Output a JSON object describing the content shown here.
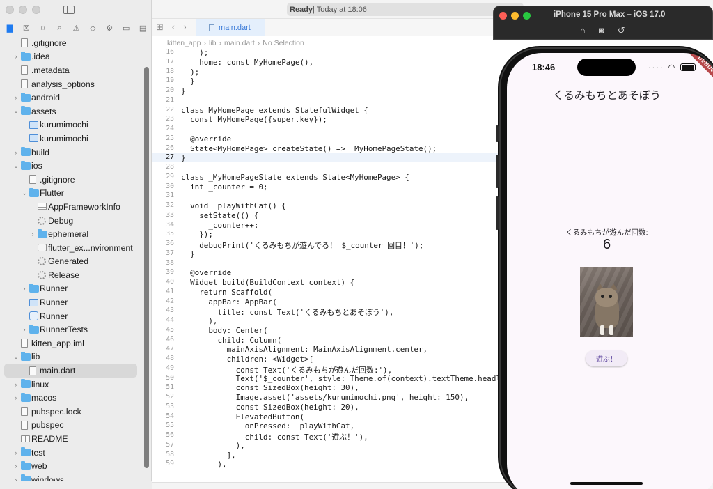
{
  "colors": {
    "accent": "#1f7bf0",
    "sidebar_bg": "#ececec",
    "folder": "#5fb2ec",
    "app_bg": "#fcf7fc",
    "button_text": "#6750a4",
    "debug_banner": "#b8484b"
  },
  "toolbar": {
    "status_bold": "Ready",
    "status_rest": " | Today at 18:06",
    "tab_label": "main.dart"
  },
  "breadcrumb": {
    "items": [
      "kitten_app",
      "lib",
      "main.dart",
      "No Selection"
    ]
  },
  "navigator": {
    "tree": [
      {
        "label": ".gitignore",
        "icon": "file",
        "depth": 0,
        "chevron": false
      },
      {
        "label": ".idea",
        "icon": "folder",
        "depth": 0,
        "chevron": "right"
      },
      {
        "label": ".metadata",
        "icon": "file",
        "depth": 0,
        "chevron": false
      },
      {
        "label": "analysis_options",
        "icon": "file",
        "depth": 0,
        "chevron": false
      },
      {
        "label": "android",
        "icon": "folder",
        "depth": 0,
        "chevron": "right"
      },
      {
        "label": "assets",
        "icon": "folder",
        "depth": 0,
        "chevron": "down"
      },
      {
        "label": "kurumimochi",
        "icon": "image",
        "depth": 1,
        "chevron": false
      },
      {
        "label": "kurumimochi",
        "icon": "image",
        "depth": 1,
        "chevron": false
      },
      {
        "label": "build",
        "icon": "folder",
        "depth": 0,
        "chevron": "right"
      },
      {
        "label": "ios",
        "icon": "folder",
        "depth": 0,
        "chevron": "down"
      },
      {
        "label": ".gitignore",
        "icon": "file",
        "depth": 1,
        "chevron": false
      },
      {
        "label": "Flutter",
        "icon": "folder",
        "depth": 1,
        "chevron": "down"
      },
      {
        "label": "AppFrameworkInfo",
        "icon": "plist",
        "depth": 2,
        "chevron": false
      },
      {
        "label": "Debug",
        "icon": "gear",
        "depth": 2,
        "chevron": false
      },
      {
        "label": "ephemeral",
        "icon": "folder",
        "depth": 2,
        "chevron": "right"
      },
      {
        "label": "flutter_ex...nvironment",
        "icon": "xcfg",
        "depth": 2,
        "chevron": false
      },
      {
        "label": "Generated",
        "icon": "gear",
        "depth": 2,
        "chevron": false
      },
      {
        "label": "Release",
        "icon": "gear",
        "depth": 2,
        "chevron": false
      },
      {
        "label": "Runner",
        "icon": "folder",
        "depth": 1,
        "chevron": "right"
      },
      {
        "label": "Runner",
        "icon": "image",
        "depth": 1,
        "chevron": false
      },
      {
        "label": "Runner",
        "icon": "app",
        "depth": 1,
        "chevron": false
      },
      {
        "label": "RunnerTests",
        "icon": "folder",
        "depth": 1,
        "chevron": "right"
      },
      {
        "label": "kitten_app.iml",
        "icon": "file",
        "depth": 0,
        "chevron": false
      },
      {
        "label": "lib",
        "icon": "folder",
        "depth": 0,
        "chevron": "down"
      },
      {
        "label": "main.dart",
        "icon": "file",
        "depth": 1,
        "chevron": false,
        "selected": true
      },
      {
        "label": "linux",
        "icon": "folder",
        "depth": 0,
        "chevron": "right"
      },
      {
        "label": "macos",
        "icon": "folder",
        "depth": 0,
        "chevron": "right"
      },
      {
        "label": "pubspec.lock",
        "icon": "file",
        "depth": 0,
        "chevron": false
      },
      {
        "label": "pubspec",
        "icon": "file",
        "depth": 0,
        "chevron": false
      },
      {
        "label": "README",
        "icon": "book",
        "depth": 0,
        "chevron": false
      },
      {
        "label": "test",
        "icon": "folder",
        "depth": 0,
        "chevron": "right"
      },
      {
        "label": "web",
        "icon": "folder",
        "depth": 0,
        "chevron": "right"
      },
      {
        "label": "windows",
        "icon": "folder",
        "depth": 0,
        "chevron": "right"
      }
    ]
  },
  "code": {
    "current_line": 27,
    "lines": [
      {
        "n": 16,
        "t": "    );"
      },
      {
        "n": 17,
        "t": "    home: const MyHomePage(),"
      },
      {
        "n": 18,
        "t": "  );"
      },
      {
        "n": 19,
        "t": "  }"
      },
      {
        "n": 20,
        "t": "}"
      },
      {
        "n": 21,
        "t": ""
      },
      {
        "n": 22,
        "t": "class MyHomePage extends StatefulWidget {"
      },
      {
        "n": 23,
        "t": "  const MyHomePage({super.key});"
      },
      {
        "n": 24,
        "t": ""
      },
      {
        "n": 25,
        "t": "  @override"
      },
      {
        "n": 26,
        "t": "  State<MyHomePage> createState() => _MyHomePageState();"
      },
      {
        "n": 27,
        "t": "}"
      },
      {
        "n": 28,
        "t": ""
      },
      {
        "n": 29,
        "t": "class _MyHomePageState extends State<MyHomePage> {"
      },
      {
        "n": 30,
        "t": "  int _counter = 0;"
      },
      {
        "n": 31,
        "t": ""
      },
      {
        "n": 32,
        "t": "  void _playWithCat() {"
      },
      {
        "n": 33,
        "t": "    setState(() {"
      },
      {
        "n": 34,
        "t": "      _counter++;"
      },
      {
        "n": 35,
        "t": "    });"
      },
      {
        "n": 36,
        "t": "    debugPrint('くるみもちが遊んでる！ $_counter 回目！');"
      },
      {
        "n": 37,
        "t": "  }"
      },
      {
        "n": 38,
        "t": ""
      },
      {
        "n": 39,
        "t": "  @override"
      },
      {
        "n": 40,
        "t": "  Widget build(BuildContext context) {"
      },
      {
        "n": 41,
        "t": "    return Scaffold("
      },
      {
        "n": 42,
        "t": "      appBar: AppBar("
      },
      {
        "n": 43,
        "t": "        title: const Text('くるみもちとあそぼう'),"
      },
      {
        "n": 44,
        "t": "      ),"
      },
      {
        "n": 45,
        "t": "      body: Center("
      },
      {
        "n": 46,
        "t": "        child: Column("
      },
      {
        "n": 47,
        "t": "          mainAxisAlignment: MainAxisAlignment.center,"
      },
      {
        "n": 48,
        "t": "          children: <Widget>["
      },
      {
        "n": 49,
        "t": "            const Text('くるみもちが遊んだ回数:'),"
      },
      {
        "n": 50,
        "t": "            Text('$_counter', style: Theme.of(context).textTheme.headlineMe"
      },
      {
        "n": 51,
        "t": "            const SizedBox(height: 30),"
      },
      {
        "n": 52,
        "t": "            Image.asset('assets/kurumimochi.png', height: 150),"
      },
      {
        "n": 53,
        "t": "            const SizedBox(height: 20),"
      },
      {
        "n": 54,
        "t": "            ElevatedButton("
      },
      {
        "n": 55,
        "t": "              onPressed: _playWithCat,"
      },
      {
        "n": 56,
        "t": "              child: const Text('遊ぶ！'),"
      },
      {
        "n": 57,
        "t": "            ),"
      },
      {
        "n": 58,
        "t": "          ],"
      },
      {
        "n": 59,
        "t": "        ),"
      }
    ]
  },
  "simulator": {
    "window_title": "iPhone 15 Pro Max – iOS 17.0",
    "status_time": "18:46",
    "debug_banner": "DEBUG",
    "app_title": "くるみもちとあそぼう",
    "counter_label": "くるみもちが遊んだ回数:",
    "counter_value": "6",
    "play_button": "遊ぶ！"
  }
}
